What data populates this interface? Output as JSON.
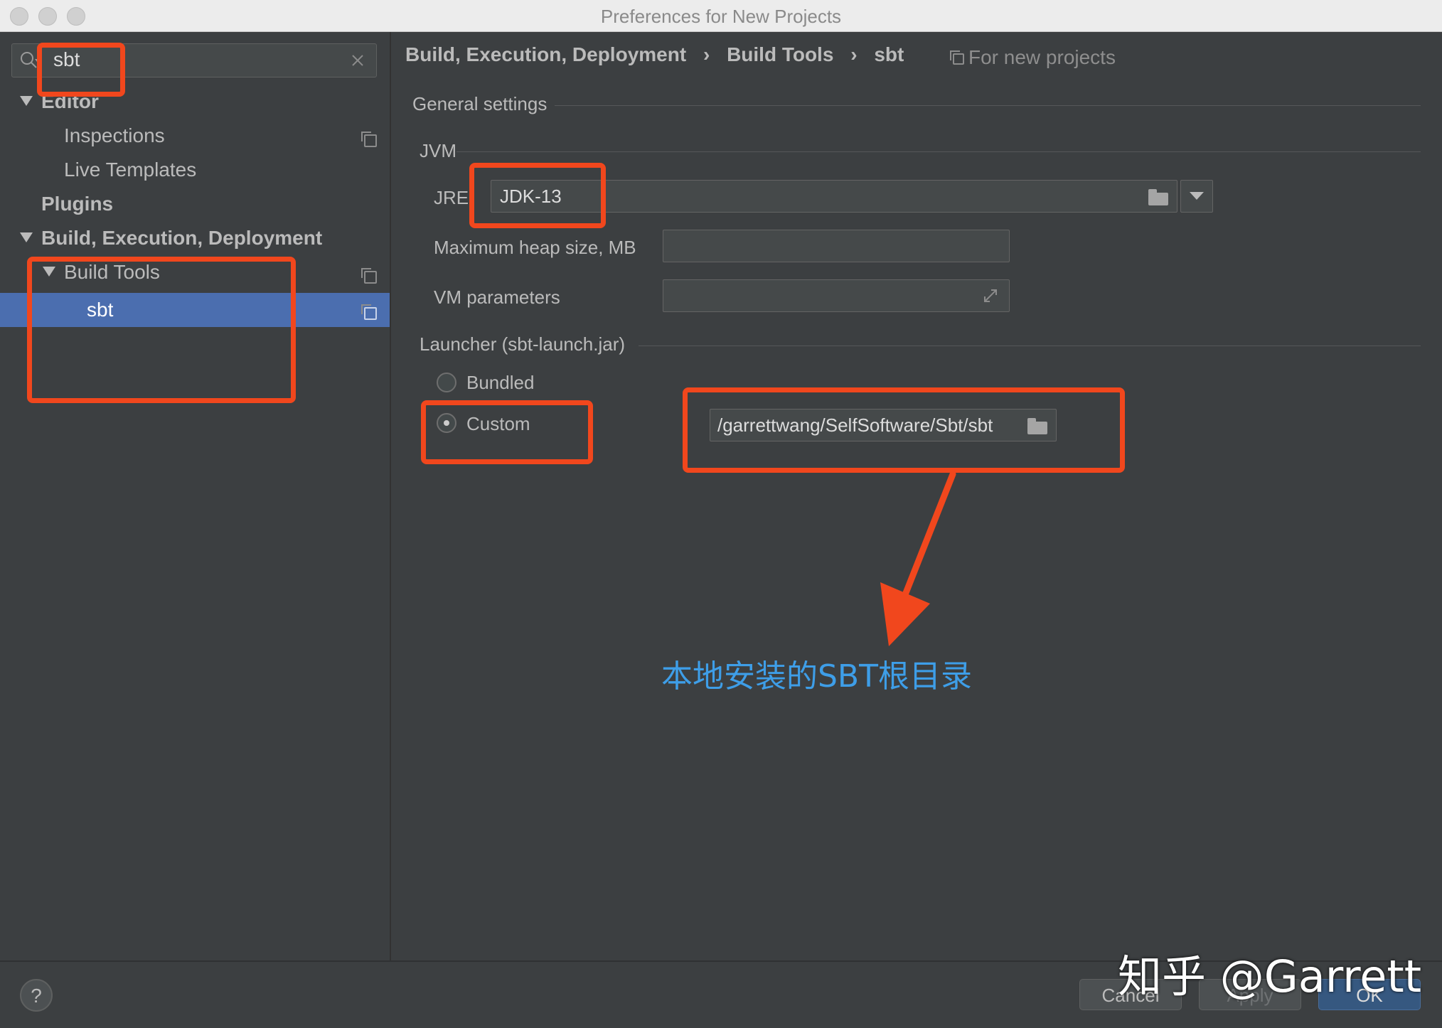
{
  "window": {
    "title": "Preferences for New Projects"
  },
  "search": {
    "value": "sbt"
  },
  "sidebar": {
    "editor": "Editor",
    "inspections": "Inspections",
    "live_templates": "Live Templates",
    "plugins": "Plugins",
    "build_execution_deployment": "Build, Execution, Deployment",
    "build_tools": "Build Tools",
    "sbt": "sbt"
  },
  "breadcrumb": {
    "part1": "Build, Execution, Deployment",
    "sep": "›",
    "part2": "Build Tools",
    "part3": "sbt",
    "for_new_projects": "For new projects"
  },
  "settings": {
    "general_settings": "General settings",
    "jvm": "JVM",
    "jre_label": "JRE:",
    "jre_value": "JDK-13",
    "max_heap_label": "Maximum heap size, MB",
    "max_heap_value": "",
    "vm_params_label": "VM parameters",
    "vm_params_value": "",
    "launcher": "Launcher (sbt-launch.jar)",
    "bundled": "Bundled",
    "custom": "Custom",
    "custom_path": "/garrettwang/SelfSoftware/Sbt/sbt"
  },
  "annotation": {
    "text": "本地安装的SBT根目录",
    "color": "#3e9ee8",
    "box_color": "#f1471d"
  },
  "buttons": {
    "help": "?",
    "cancel": "Cancel",
    "apply": "Apply",
    "ok": "OK"
  },
  "watermark": "知乎 @Garrett"
}
